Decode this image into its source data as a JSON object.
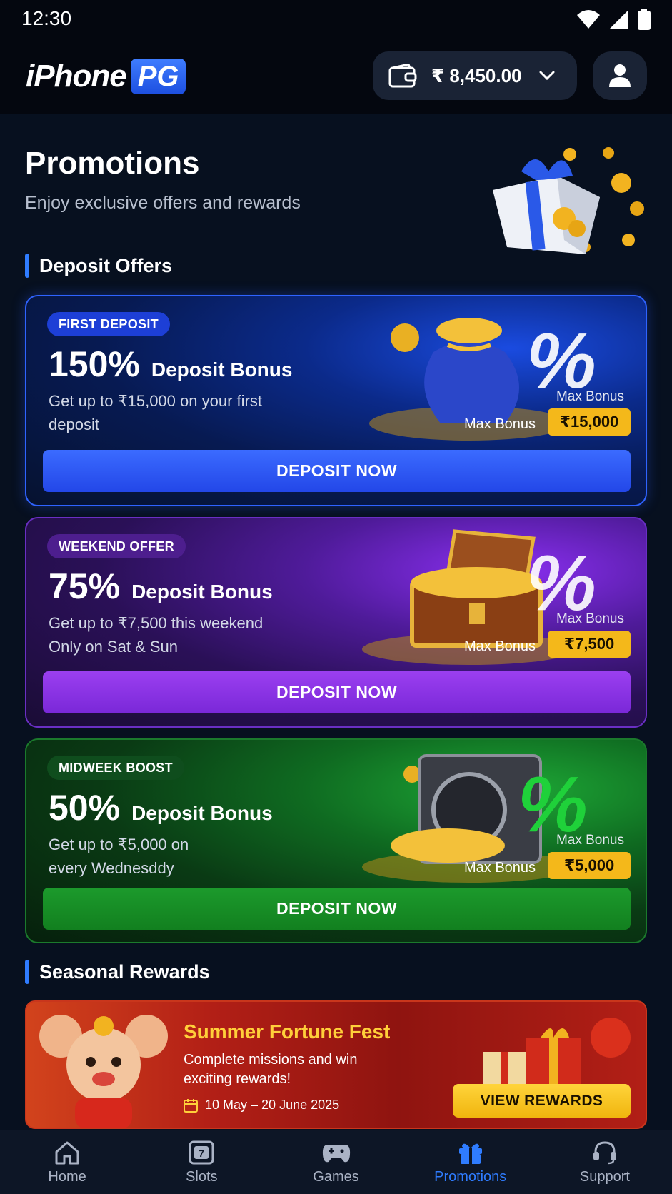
{
  "status_bar": {
    "time": "12:30"
  },
  "header": {
    "logo_text": "iPhone",
    "logo_badge": "PG",
    "wallet_amount": "₹ 8,450.00"
  },
  "page": {
    "title": "Promotions",
    "subtitle": "Enjoy exclusive offers and rewards"
  },
  "deposit_section": {
    "title": "Deposit Offers",
    "offers": [
      {
        "tag": "FIRST DEPOSIT",
        "percent": "150%",
        "bonus_label": "Deposit Bonus",
        "description": "Get up to ₹15,000 on your first deposit",
        "max_bonus_small": "Max Bonus",
        "max_bonus_label": "Max Bonus",
        "max_bonus_value": "₹15,000",
        "button": "DEPOSIT NOW"
      },
      {
        "tag": "WEEKEND OFFER",
        "percent": "75%",
        "bonus_label": "Deposit Bonus",
        "description": "Get up to ₹7,500 this weekend Only on Sat & Sun",
        "max_bonus_small": "Max Bonus",
        "max_bonus_label": "Max Bonus",
        "max_bonus_value": "₹7,500",
        "button": "DEPOSIT NOW"
      },
      {
        "tag": "MIDWEEK BOOST",
        "percent": "50%",
        "bonus_label": "Deposit Bonus",
        "description": "Get up to ₹5,000 on every Wednesddy",
        "max_bonus_small": "Max Bonus",
        "max_bonus_label": "Max Bonus",
        "max_bonus_value": "₹5,000",
        "button": "DEPOSIT NOW"
      }
    ]
  },
  "seasonal_section": {
    "title": "Seasonal Rewards",
    "card": {
      "title": "Summer Fortune Fest",
      "description": "Complete missions and win exciting rewards!",
      "date": "10 May – 20 June 2025",
      "button": "VIEW REWARDS"
    }
  },
  "bottom_nav": {
    "items": [
      {
        "label": "Home",
        "icon": "home-icon"
      },
      {
        "label": "Slots",
        "icon": "slots-icon"
      },
      {
        "label": "Games",
        "icon": "gamepad-icon"
      },
      {
        "label": "Promotions",
        "icon": "gift-icon",
        "active": true
      },
      {
        "label": "Support",
        "icon": "headset-icon"
      }
    ]
  },
  "colors": {
    "accent": "#2f7cff",
    "gold": "#f4b81a",
    "background": "#07101f"
  }
}
